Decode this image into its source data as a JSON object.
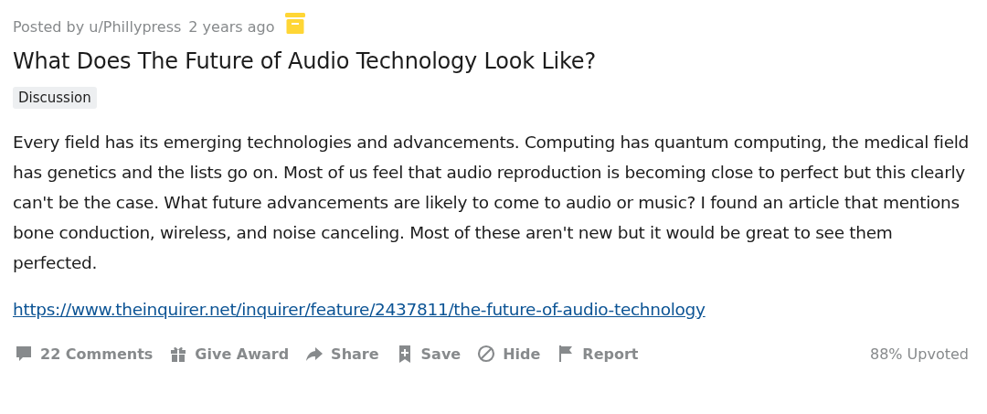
{
  "post": {
    "posted_by": "Posted by u/Phillypress",
    "time": "2 years ago",
    "archived": true,
    "title": "What Does The Future of Audio Technology Look Like?",
    "flair": "Discussion",
    "body": "Every field has its emerging technologies and advancements. Computing has quantum computing, the medical field has genetics and the lists go on. Most of us feel that audio reproduction is becoming close to perfect but this clearly can't be the case. What future advancements are likely to come to audio or music? I found an article that mentions bone conduction, wireless, and noise canceling. Most of these aren't new but it would be great to see them perfected.",
    "link": "https://www.theinquirer.net/inquirer/feature/2437811/the-future-of-audio-technology",
    "actions": [
      {
        "kind": "comments",
        "label": "22 Comments"
      },
      {
        "kind": "award",
        "label": "Give Award"
      },
      {
        "kind": "share",
        "label": "Share"
      },
      {
        "kind": "save",
        "label": "Save"
      },
      {
        "kind": "hide",
        "label": "Hide"
      },
      {
        "kind": "report",
        "label": "Report"
      }
    ],
    "upvoted": "88% Upvoted"
  }
}
